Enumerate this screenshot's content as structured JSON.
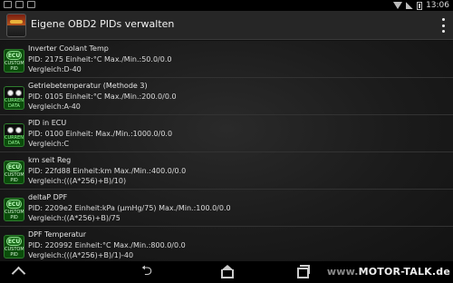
{
  "statusbar": {
    "time": "13:06"
  },
  "appbar": {
    "title": "Eigene OBD2 PIDs verwalten"
  },
  "items": [
    {
      "icon": "ecu-custom-pid-icon",
      "badge_top": "ECU",
      "badge_bottom": [
        "CUSTOM",
        "PID"
      ],
      "name": "Inverter Coolant Temp",
      "details": "PID: 2175  Einheit:°C Max./Min.:50.0/0.0",
      "formula": "Vergleich:D-40"
    },
    {
      "icon": "current-data-icon",
      "badge_top": "",
      "badge_bottom": [
        "CURRENT",
        "DATA"
      ],
      "name": "Getriebetemperatur (Methode 3)",
      "details": "PID: 0105  Einheit:°C Max./Min.:200.0/0.0",
      "formula": "Vergleich:A-40"
    },
    {
      "icon": "current-data-icon",
      "badge_top": "",
      "badge_bottom": [
        "CURRENT",
        "DATA"
      ],
      "name": "PID  in ECU",
      "details": "PID: 0100  Einheit: Max./Min.:1000.0/0.0",
      "formula": "Vergleich:C"
    },
    {
      "icon": "ecu-custom-pid-icon",
      "badge_top": "ECU",
      "badge_bottom": [
        "CUSTOM",
        "PID"
      ],
      "name": "km seit Reg",
      "details": "PID: 22fd88  Einheit:km Max./Min.:400.0/0.0",
      "formula": "Vergleich:(((A*256)+B)/10)"
    },
    {
      "icon": "ecu-custom-pid-icon",
      "badge_top": "ECU",
      "badge_bottom": [
        "CUSTOM",
        "PID"
      ],
      "name": "deltaP DPF",
      "details": "PID: 2209e2  Einheit:kPa (µmHg/75) Max./Min.:100.0/0.0",
      "formula": "Vergleich:((A*256)+B)/75"
    },
    {
      "icon": "ecu-custom-pid-icon",
      "badge_top": "ECU",
      "badge_bottom": [
        "CUSTOM",
        "PID"
      ],
      "name": "DPF Temperatur",
      "details": "PID: 220992  Einheit:°C Max./Min.:800.0/0.0",
      "formula": "Vergleich:(((A*256)+B)/1)-40"
    }
  ],
  "navbar": {
    "back_glyph": "⮌"
  },
  "watermark": {
    "prefix": "www.",
    "brand": "MOTOR-TALK.de"
  }
}
